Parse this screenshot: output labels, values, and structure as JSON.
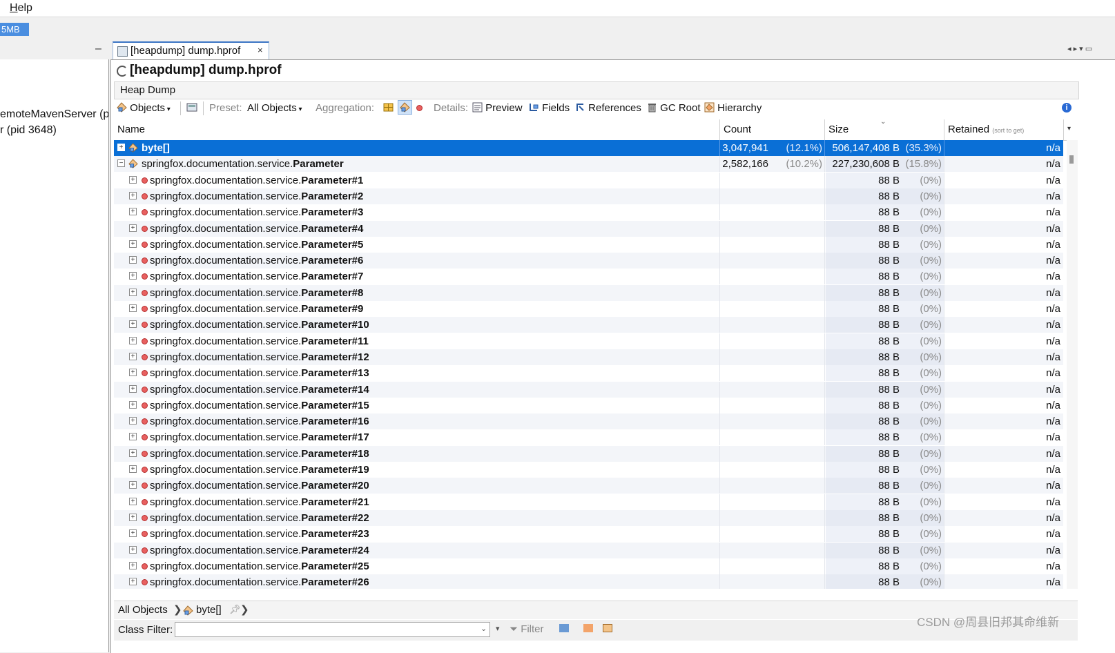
{
  "menu": {
    "help_first": "H",
    "help_rest": "elp"
  },
  "memory_indicator": "5MB",
  "left_panel": {
    "lines": [
      "emoteMavenServer (p",
      "r (pid 3648)"
    ],
    "minimize": "–"
  },
  "tab": {
    "label": "[heapdump] dump.hprof",
    "close": "×"
  },
  "editor_controls": "◂ ▸ ▾ ▭",
  "doc_title": "[heapdump] dump.hprof",
  "section_label": "Heap Dump",
  "toolbar": {
    "objects": "Objects",
    "preset_label": "Preset:",
    "preset_value": "All Objects",
    "aggregation_label": "Aggregation:",
    "details_label": "Details:",
    "preview": "Preview",
    "fields": "Fields",
    "references": "References",
    "gc_root": "GC Root",
    "hierarchy": "Hierarchy"
  },
  "table": {
    "headers": {
      "name": "Name",
      "count": "Count",
      "size": "Size",
      "retained": "Retained",
      "retained_hint": "(sort to get)"
    },
    "rows": [
      {
        "kind": "class",
        "expander": "+",
        "prefix": "",
        "bold": "byte[]",
        "count": "3,047,941",
        "count_pct": "(12.1%)",
        "size": "506,147,408 B",
        "size_pct": "(35.3%)",
        "retained": "n/a",
        "selected": true
      },
      {
        "kind": "class",
        "expander": "−",
        "prefix": "springfox.documentation.service.",
        "bold": "Parameter",
        "count": "2,582,166",
        "count_pct": "(10.2%)",
        "size": "227,230,608 B",
        "size_pct": "(15.8%)",
        "retained": "n/a",
        "selected": false
      },
      {
        "kind": "instance",
        "expander": "+",
        "prefix": "springfox.documentation.service.",
        "bold": "Parameter#1",
        "count": "",
        "count_pct": "",
        "size": "88 B",
        "size_pct": "(0%)",
        "retained": "n/a"
      },
      {
        "kind": "instance",
        "expander": "+",
        "prefix": "springfox.documentation.service.",
        "bold": "Parameter#2",
        "count": "",
        "count_pct": "",
        "size": "88 B",
        "size_pct": "(0%)",
        "retained": "n/a"
      },
      {
        "kind": "instance",
        "expander": "+",
        "prefix": "springfox.documentation.service.",
        "bold": "Parameter#3",
        "count": "",
        "count_pct": "",
        "size": "88 B",
        "size_pct": "(0%)",
        "retained": "n/a"
      },
      {
        "kind": "instance",
        "expander": "+",
        "prefix": "springfox.documentation.service.",
        "bold": "Parameter#4",
        "count": "",
        "count_pct": "",
        "size": "88 B",
        "size_pct": "(0%)",
        "retained": "n/a"
      },
      {
        "kind": "instance",
        "expander": "+",
        "prefix": "springfox.documentation.service.",
        "bold": "Parameter#5",
        "count": "",
        "count_pct": "",
        "size": "88 B",
        "size_pct": "(0%)",
        "retained": "n/a"
      },
      {
        "kind": "instance",
        "expander": "+",
        "prefix": "springfox.documentation.service.",
        "bold": "Parameter#6",
        "count": "",
        "count_pct": "",
        "size": "88 B",
        "size_pct": "(0%)",
        "retained": "n/a"
      },
      {
        "kind": "instance",
        "expander": "+",
        "prefix": "springfox.documentation.service.",
        "bold": "Parameter#7",
        "count": "",
        "count_pct": "",
        "size": "88 B",
        "size_pct": "(0%)",
        "retained": "n/a"
      },
      {
        "kind": "instance",
        "expander": "+",
        "prefix": "springfox.documentation.service.",
        "bold": "Parameter#8",
        "count": "",
        "count_pct": "",
        "size": "88 B",
        "size_pct": "(0%)",
        "retained": "n/a"
      },
      {
        "kind": "instance",
        "expander": "+",
        "prefix": "springfox.documentation.service.",
        "bold": "Parameter#9",
        "count": "",
        "count_pct": "",
        "size": "88 B",
        "size_pct": "(0%)",
        "retained": "n/a"
      },
      {
        "kind": "instance",
        "expander": "+",
        "prefix": "springfox.documentation.service.",
        "bold": "Parameter#10",
        "count": "",
        "count_pct": "",
        "size": "88 B",
        "size_pct": "(0%)",
        "retained": "n/a"
      },
      {
        "kind": "instance",
        "expander": "+",
        "prefix": "springfox.documentation.service.",
        "bold": "Parameter#11",
        "count": "",
        "count_pct": "",
        "size": "88 B",
        "size_pct": "(0%)",
        "retained": "n/a"
      },
      {
        "kind": "instance",
        "expander": "+",
        "prefix": "springfox.documentation.service.",
        "bold": "Parameter#12",
        "count": "",
        "count_pct": "",
        "size": "88 B",
        "size_pct": "(0%)",
        "retained": "n/a"
      },
      {
        "kind": "instance",
        "expander": "+",
        "prefix": "springfox.documentation.service.",
        "bold": "Parameter#13",
        "count": "",
        "count_pct": "",
        "size": "88 B",
        "size_pct": "(0%)",
        "retained": "n/a"
      },
      {
        "kind": "instance",
        "expander": "+",
        "prefix": "springfox.documentation.service.",
        "bold": "Parameter#14",
        "count": "",
        "count_pct": "",
        "size": "88 B",
        "size_pct": "(0%)",
        "retained": "n/a"
      },
      {
        "kind": "instance",
        "expander": "+",
        "prefix": "springfox.documentation.service.",
        "bold": "Parameter#15",
        "count": "",
        "count_pct": "",
        "size": "88 B",
        "size_pct": "(0%)",
        "retained": "n/a"
      },
      {
        "kind": "instance",
        "expander": "+",
        "prefix": "springfox.documentation.service.",
        "bold": "Parameter#16",
        "count": "",
        "count_pct": "",
        "size": "88 B",
        "size_pct": "(0%)",
        "retained": "n/a"
      },
      {
        "kind": "instance",
        "expander": "+",
        "prefix": "springfox.documentation.service.",
        "bold": "Parameter#17",
        "count": "",
        "count_pct": "",
        "size": "88 B",
        "size_pct": "(0%)",
        "retained": "n/a"
      },
      {
        "kind": "instance",
        "expander": "+",
        "prefix": "springfox.documentation.service.",
        "bold": "Parameter#18",
        "count": "",
        "count_pct": "",
        "size": "88 B",
        "size_pct": "(0%)",
        "retained": "n/a"
      },
      {
        "kind": "instance",
        "expander": "+",
        "prefix": "springfox.documentation.service.",
        "bold": "Parameter#19",
        "count": "",
        "count_pct": "",
        "size": "88 B",
        "size_pct": "(0%)",
        "retained": "n/a"
      },
      {
        "kind": "instance",
        "expander": "+",
        "prefix": "springfox.documentation.service.",
        "bold": "Parameter#20",
        "count": "",
        "count_pct": "",
        "size": "88 B",
        "size_pct": "(0%)",
        "retained": "n/a"
      },
      {
        "kind": "instance",
        "expander": "+",
        "prefix": "springfox.documentation.service.",
        "bold": "Parameter#21",
        "count": "",
        "count_pct": "",
        "size": "88 B",
        "size_pct": "(0%)",
        "retained": "n/a"
      },
      {
        "kind": "instance",
        "expander": "+",
        "prefix": "springfox.documentation.service.",
        "bold": "Parameter#22",
        "count": "",
        "count_pct": "",
        "size": "88 B",
        "size_pct": "(0%)",
        "retained": "n/a"
      },
      {
        "kind": "instance",
        "expander": "+",
        "prefix": "springfox.documentation.service.",
        "bold": "Parameter#23",
        "count": "",
        "count_pct": "",
        "size": "88 B",
        "size_pct": "(0%)",
        "retained": "n/a"
      },
      {
        "kind": "instance",
        "expander": "+",
        "prefix": "springfox.documentation.service.",
        "bold": "Parameter#24",
        "count": "",
        "count_pct": "",
        "size": "88 B",
        "size_pct": "(0%)",
        "retained": "n/a"
      },
      {
        "kind": "instance",
        "expander": "+",
        "prefix": "springfox.documentation.service.",
        "bold": "Parameter#25",
        "count": "",
        "count_pct": "",
        "size": "88 B",
        "size_pct": "(0%)",
        "retained": "n/a"
      },
      {
        "kind": "instance",
        "expander": "+",
        "prefix": "springfox.documentation.service.",
        "bold": "Parameter#26",
        "count": "",
        "count_pct": "",
        "size": "88 B",
        "size_pct": "(0%)",
        "retained": "n/a"
      }
    ]
  },
  "breadcrumb": {
    "root": "All Objects",
    "current": "byte[]"
  },
  "class_filter": {
    "label": "Class Filter:",
    "value": "",
    "filter_button": "Filter"
  },
  "watermark": "CSDN @周县旧邦其命维新",
  "colors": {
    "selection": "#0a6fd6",
    "accent": "#3a74c4",
    "instance_dot": "#e86060"
  }
}
